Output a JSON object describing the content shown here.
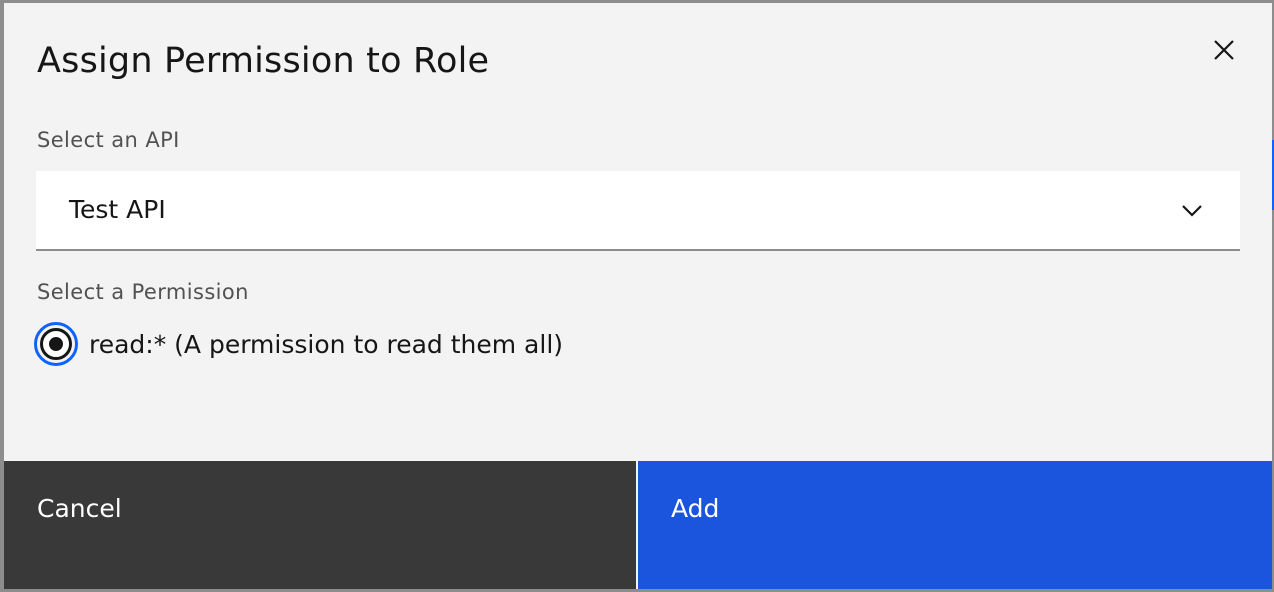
{
  "modal": {
    "title": "Assign Permission to Role",
    "close_icon": "close-icon"
  },
  "api_select": {
    "label": "Select an API",
    "value": "Test API",
    "icon": "chevron-down-icon"
  },
  "permission": {
    "label": "Select a Permission",
    "options": [
      {
        "label": "read:* (A permission to read them all)",
        "selected": true
      }
    ]
  },
  "footer": {
    "cancel_label": "Cancel",
    "add_label": "Add"
  },
  "colors": {
    "primary": "#1c55dd",
    "secondary": "#393939",
    "focus": "#0f62fe",
    "modal_bg": "#f3f3f3"
  }
}
